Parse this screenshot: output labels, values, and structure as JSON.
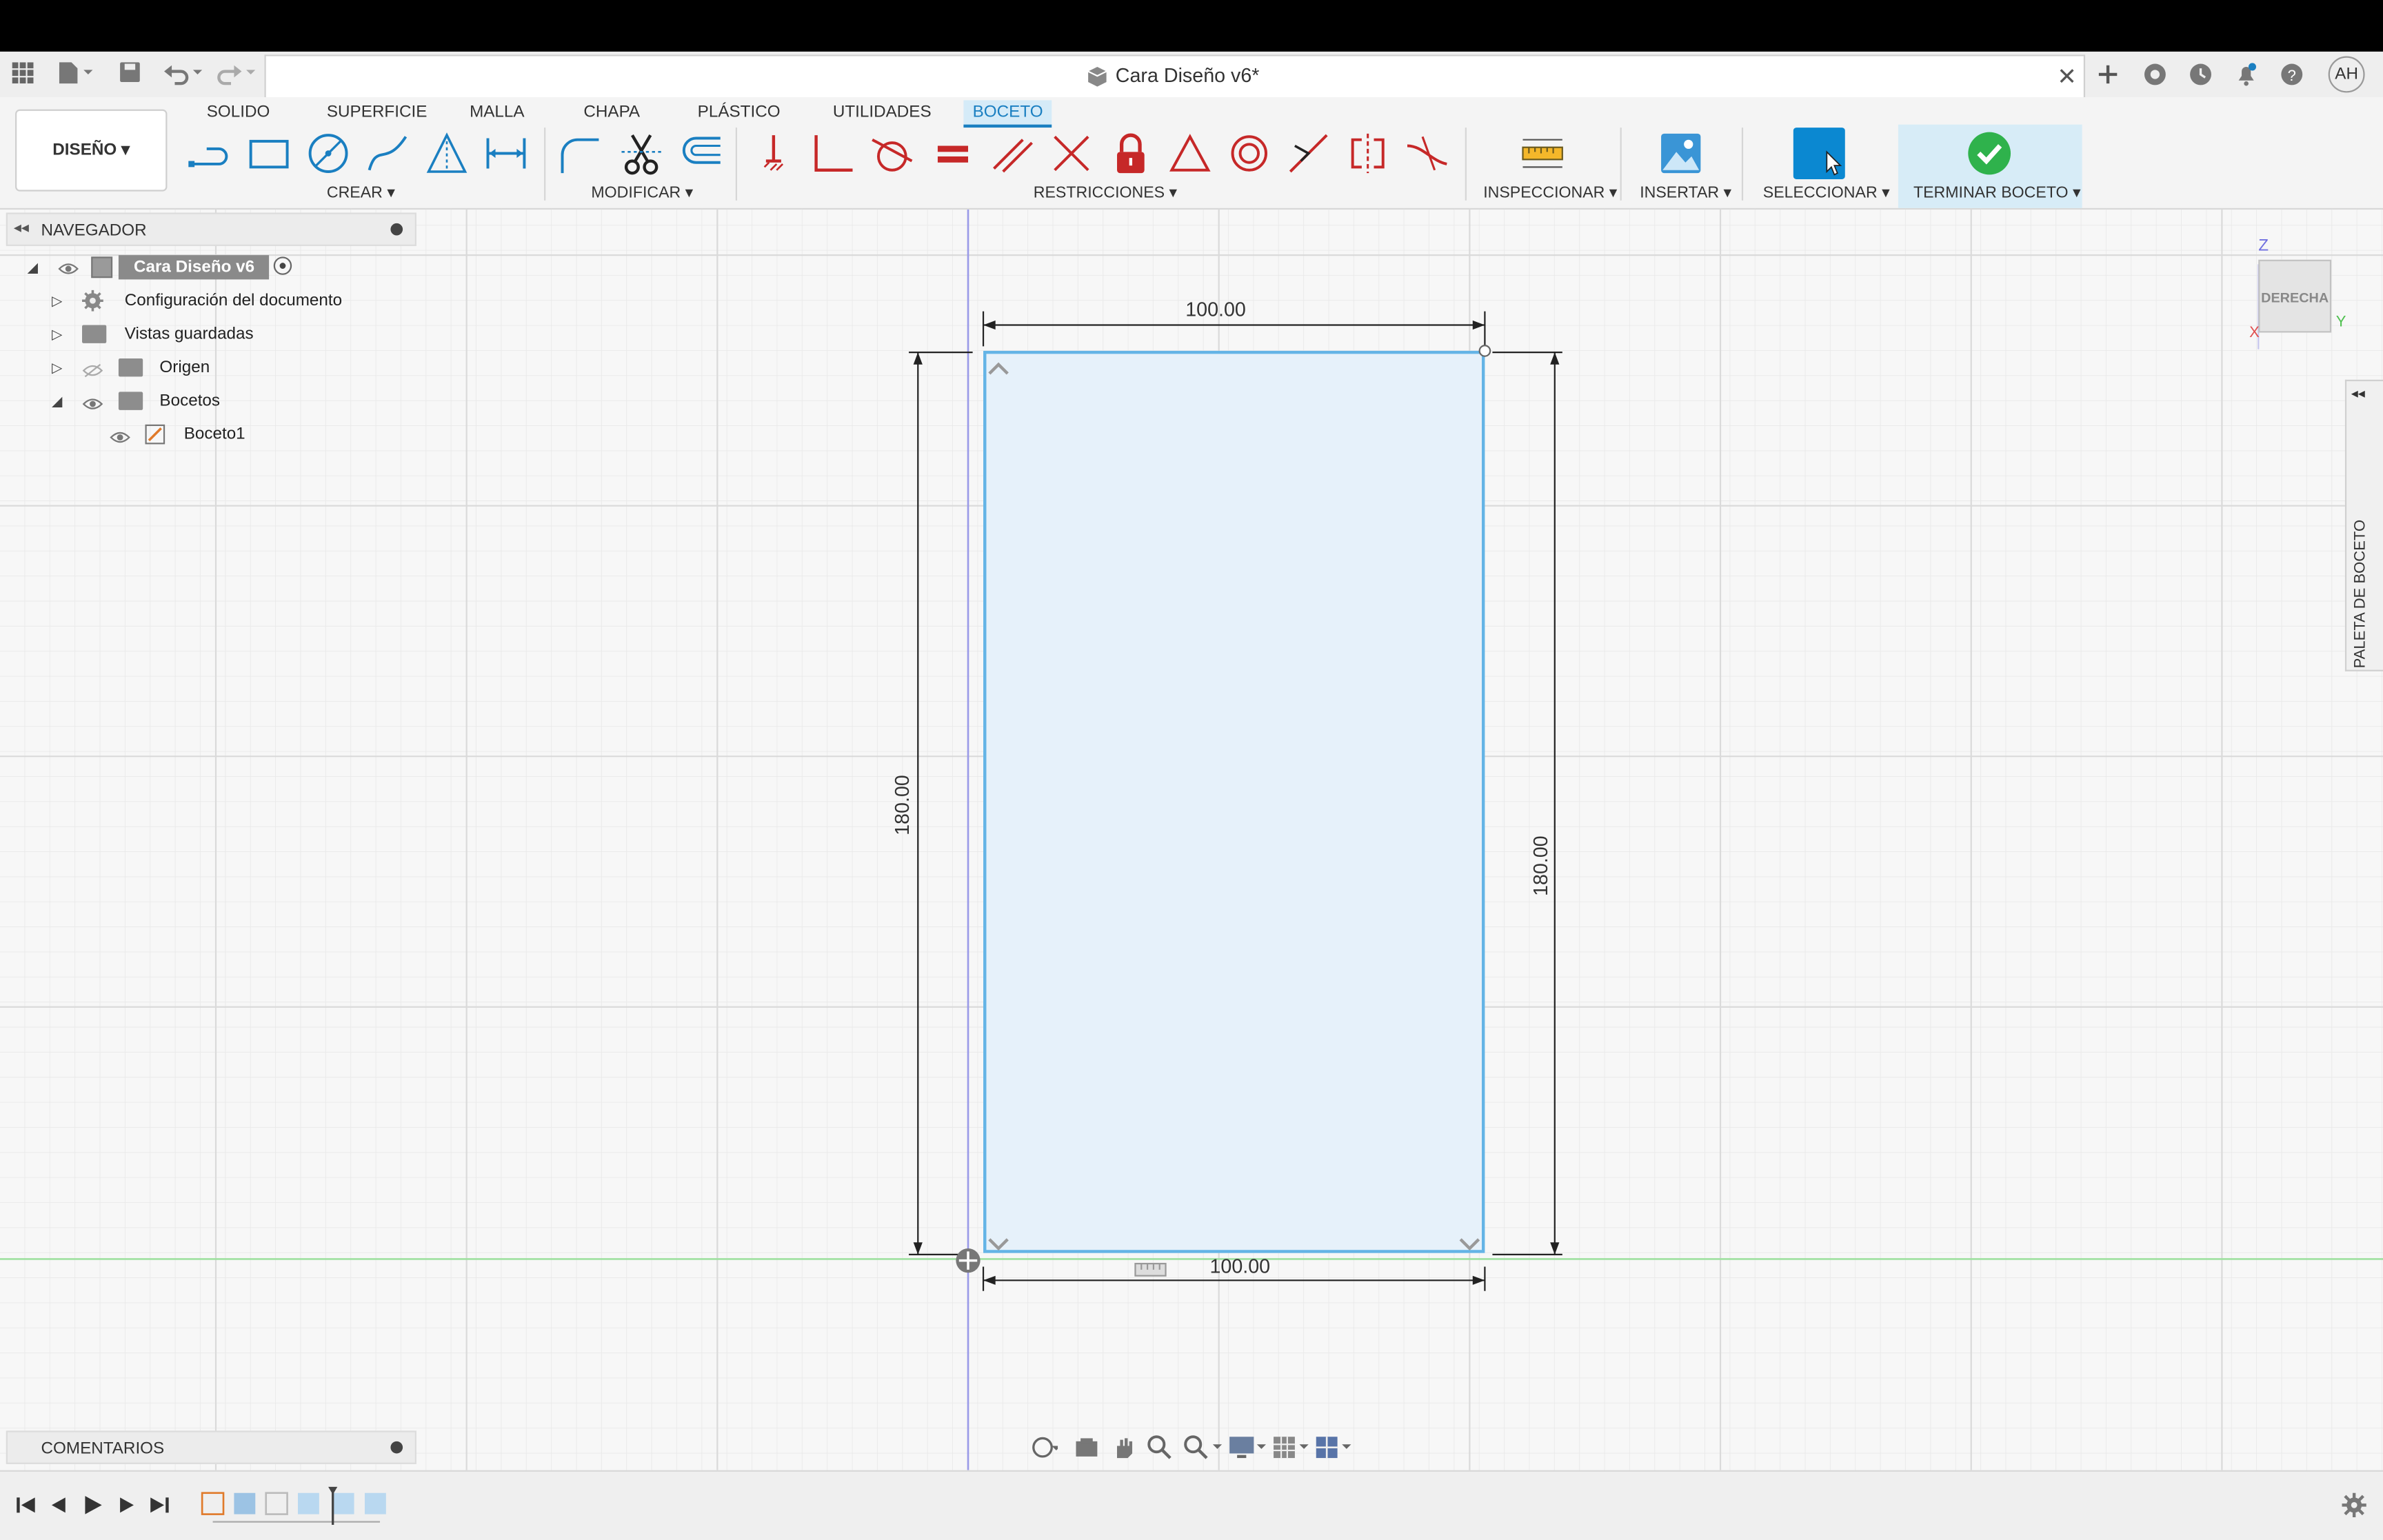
{
  "document": {
    "title": "Cara Diseño v6*"
  },
  "user": {
    "initials": "AH"
  },
  "workspace": {
    "label": "DISEÑO ▾"
  },
  "ribbon": {
    "tabs": [
      {
        "label": "SOLIDO"
      },
      {
        "label": "SUPERFICIE"
      },
      {
        "label": "MALLA"
      },
      {
        "label": "CHAPA"
      },
      {
        "label": "PLÁSTICO"
      },
      {
        "label": "UTILIDADES"
      },
      {
        "label": "BOCETO",
        "active": true
      }
    ],
    "groups": {
      "create": "CREAR ▾",
      "modify": "MODIFICAR ▾",
      "constraints": "RESTRICCIONES ▾",
      "inspect": "INSPECCIONAR ▾",
      "insert": "INSERTAR ▾",
      "select": "SELECCIONAR ▾",
      "finish": "TERMINAR BOCETO ▾"
    }
  },
  "browser": {
    "title": "NAVEGADOR",
    "root": "Cara Diseño v6",
    "items": [
      {
        "label": "Configuración del documento"
      },
      {
        "label": "Vistas guardadas"
      },
      {
        "label": "Origen"
      },
      {
        "label": "Bocetos"
      },
      {
        "label": "Boceto1"
      }
    ]
  },
  "comments": {
    "title": "COMENTARIOS"
  },
  "viewcube": {
    "face": "DERECHA",
    "axis_z": "Z",
    "axis_x": "X",
    "axis_y": "Y"
  },
  "sketch_palette": {
    "label": "PALETA DE BOCETO"
  },
  "sketch": {
    "dim_top": "100.00",
    "dim_bottom": "100.00",
    "dim_left": "180.00",
    "dim_right": "180.00"
  },
  "colors": {
    "accent": "#1a7fc1",
    "profile_fill": "#e6f1fa",
    "profile_stroke": "#64b4e6",
    "constraint_red": "#c62828",
    "finish_green": "#2fb24c"
  }
}
